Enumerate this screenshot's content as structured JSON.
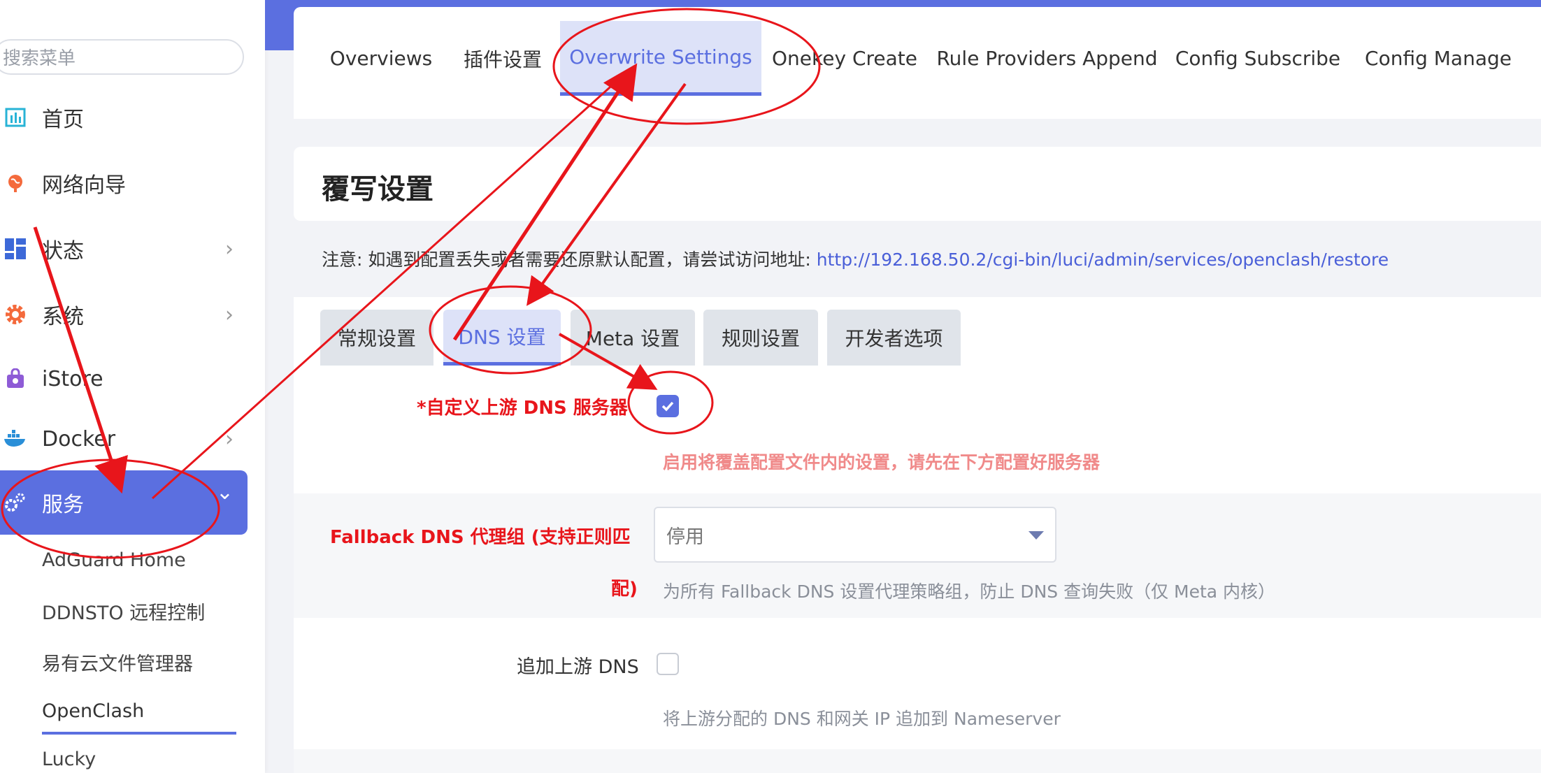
{
  "sidebar": {
    "search_placeholder": "搜索菜单",
    "items": [
      {
        "label": "首页",
        "icon": "dashboard-chart-icon"
      },
      {
        "label": "网络向导",
        "icon": "globe-icon"
      },
      {
        "label": "状态",
        "icon": "grid-icon",
        "chevron": "›"
      },
      {
        "label": "系统",
        "icon": "gear-icon",
        "chevron": "›"
      },
      {
        "label": "iStore",
        "icon": "shopping-bag-icon"
      },
      {
        "label": "Docker",
        "icon": "docker-whale-icon",
        "chevron": "›"
      },
      {
        "label": "服务",
        "icon": "gears-icon",
        "chevron": "⌄"
      }
    ],
    "sub_items": [
      "AdGuard Home",
      "DDNSTO 远程控制",
      "易有云文件管理器",
      "OpenClash",
      "Lucky"
    ],
    "accent": "#5b6fe0"
  },
  "top_tabs": [
    "Overviews",
    "插件设置",
    "Overwrite Settings",
    "Onekey Create",
    "Rule Providers Append",
    "Config Subscribe",
    "Config Manage"
  ],
  "page": {
    "title": "覆写设置",
    "notice_prefix": "注意: 如遇到配置丢失或者需要还原默认配置，请尝试访问地址: ",
    "notice_link": "http://192.168.50.2/cgi-bin/luci/admin/services/openclash/restore"
  },
  "sub_tabs": [
    "常规设置",
    "DNS 设置",
    "Meta 设置",
    "规则设置",
    "开发者选项"
  ],
  "form": {
    "custom_dns_label": "*自定义上游 DNS 服务器",
    "custom_dns_checked": true,
    "custom_dns_hint": "启用将覆盖配置文件内的设置，请先在下方配置好服务器",
    "fallback_label_line1": "Fallback DNS 代理组 (支持正则匹",
    "fallback_label_line2": "配)",
    "fallback_value": "停用",
    "fallback_hint": "为所有 Fallback DNS 设置代理策略组，防止 DNS 查询失败（仅 Meta 内核）",
    "append_dns_label": "追加上游 DNS",
    "append_dns_checked": false,
    "append_dns_hint": "将上游分配的 DNS 和网关 IP 追加到 Nameserver"
  },
  "annotation_color": "#e8151b"
}
